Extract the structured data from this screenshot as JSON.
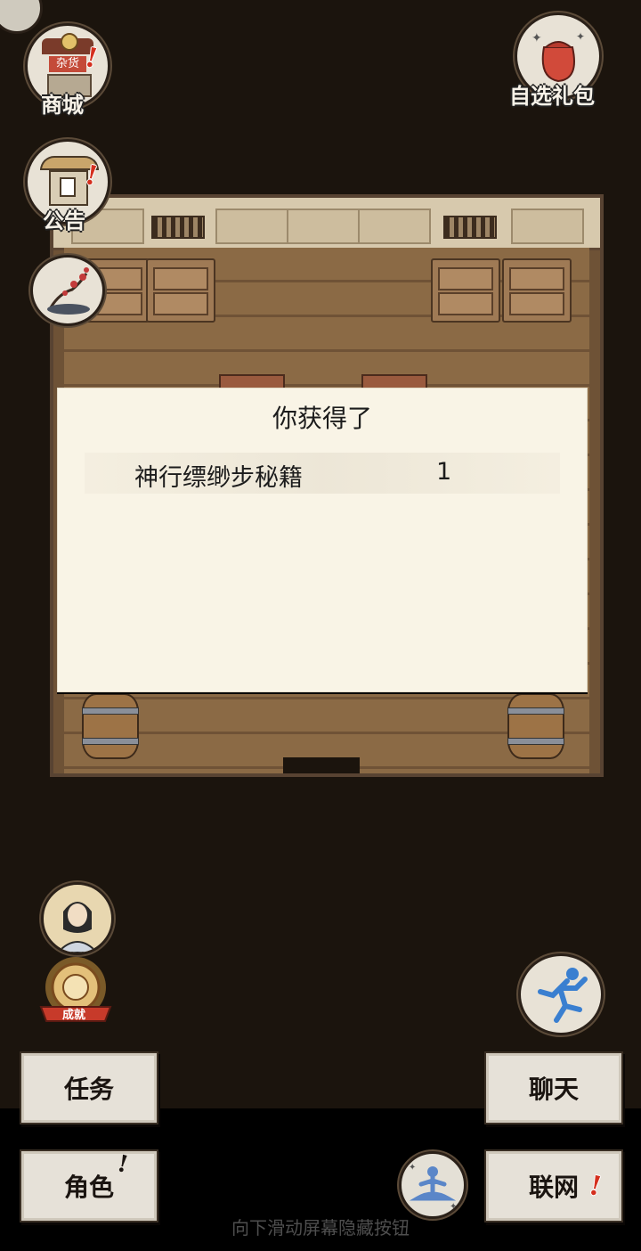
{
  "top_left": {
    "shop": {
      "label": "商城",
      "sign_text": "杂货",
      "icon": "shop-stall-icon",
      "alert": "!"
    },
    "notice": {
      "label": "公告",
      "icon": "notice-board-icon",
      "alert": "!"
    },
    "scenery": {
      "icon": "plum-blossom-icon"
    }
  },
  "top_right": {
    "gift": {
      "label": "自选礼包",
      "icon": "gift-bag-icon"
    }
  },
  "dialog": {
    "title": "你获得了",
    "items": [
      {
        "name": "神行缥缈步秘籍",
        "qty": "1"
      }
    ]
  },
  "side_left": {
    "character_portrait": {
      "icon": "hero-portrait-icon"
    },
    "achievement": {
      "label": "成就",
      "icon": "achievement-medal-icon"
    }
  },
  "side_right": {
    "run": {
      "icon": "running-figure-icon"
    }
  },
  "bottom_buttons": {
    "task": "任务",
    "role": "角色",
    "role_alert": "!",
    "chat": "聊天",
    "network": "联网",
    "network_alert": "!",
    "meditate_icon": "meditate-icon"
  },
  "hint": "向下滑动屏幕隐藏按钮",
  "colors": {
    "background": "#1b140d",
    "dialog_bg": "#f9f4e6",
    "alert_red": "#d42f1e",
    "button_bg": "#e6e1d8"
  }
}
